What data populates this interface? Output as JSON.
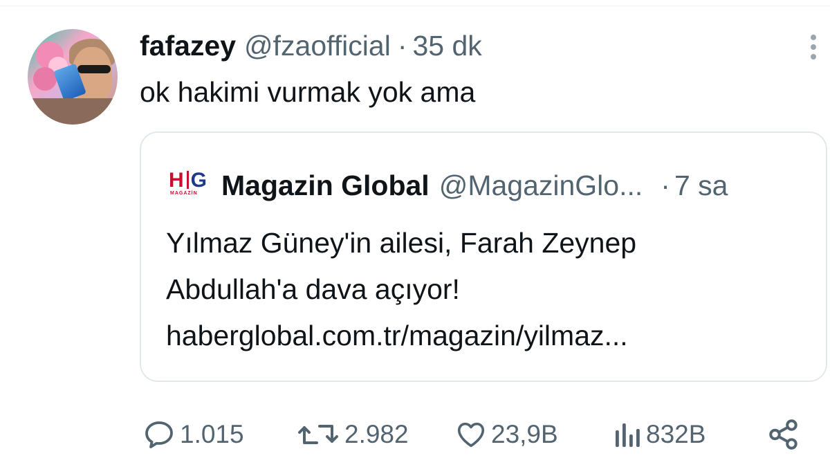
{
  "tweet": {
    "author_name": "fafazey",
    "author_handle": "@fzaofficial",
    "separator": "·",
    "time": "35 dk",
    "text": "ok hakimi vurmak yok ama"
  },
  "quote": {
    "logo_text": "HG",
    "logo_subtext": "MAGAZİN",
    "author_name": "Magazin Global",
    "author_handle": "@MagazinGlo...",
    "separator": "·",
    "time": "7 sa",
    "text_lines": [
      "Yılmaz Güney'in ailesi, Farah Zeynep",
      "Abdullah'a dava açıyor!",
      "haberglobal.com.tr/magazin/yilmaz..."
    ]
  },
  "actions": {
    "reply_count": "1.015",
    "retweet_count": "2.982",
    "like_count": "23,9B",
    "views_count": "832B"
  },
  "icons": {
    "reply": "reply-icon",
    "retweet": "retweet-icon",
    "like": "heart-icon",
    "views": "views-icon",
    "share": "share-icon",
    "more": "more-vertical-icon"
  },
  "colors": {
    "text_primary": "#0f1419",
    "text_secondary": "#536471",
    "border": "#e1e8ed",
    "logo_red": "#c8102e",
    "logo_blue": "#1f3a8a"
  }
}
